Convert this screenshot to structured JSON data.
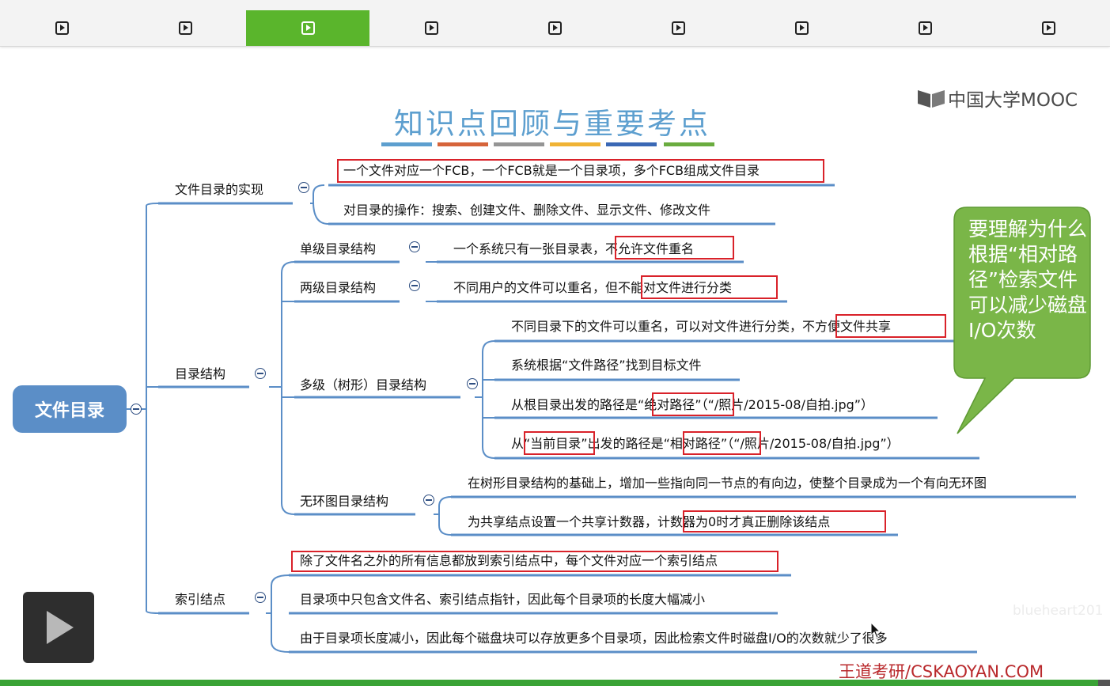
{
  "tabs": [
    {
      "icon": "play-icon",
      "active": false
    },
    {
      "icon": "play-icon",
      "active": false
    },
    {
      "icon": "play-icon",
      "active": true
    },
    {
      "icon": "play-icon",
      "active": false
    },
    {
      "icon": "play-icon",
      "active": false
    },
    {
      "icon": "play-icon",
      "active": false
    },
    {
      "icon": "play-icon",
      "active": false
    },
    {
      "icon": "play-icon",
      "active": false
    },
    {
      "icon": "play-icon",
      "active": false
    }
  ],
  "slide": {
    "title": "知识点回顾与重要考点",
    "stripe_colors": [
      "#5d9fcf",
      "#d6643a",
      "#959595",
      "#f0b335",
      "#3a68b5",
      "#6aac3f"
    ],
    "logo": "中国大学MOOC",
    "root": "文件目录",
    "branches": {
      "impl": {
        "label": "文件目录的实现",
        "items": [
          "一个文件对应一个FCB，一个FCB就是一个目录项，多个FCB组成文件目录",
          "对目录的操作：搜索、创建文件、删除文件、显示文件、修改文件"
        ]
      },
      "structure": {
        "label": "目录结构",
        "single": {
          "label": "单级目录结构",
          "desc_a": "一个系统只有一张目录表，",
          "desc_b": "不允许文件重名"
        },
        "two": {
          "label": "两级目录结构",
          "desc_a": "不同用户的文件可以重名，但",
          "desc_b": "不能对文件进行分类"
        },
        "multi": {
          "label": "多级（树形）目录结构",
          "i1a": "不同目录下的文件可以重名，可以对文件进行分类，",
          "i1b": "不方便文件共享",
          "i2": "系统根据“文件路径”找到目标文件",
          "i3a": "从根目录出发的路径是",
          "i3b": "“绝对路径”",
          "i3c": "（“/照片/2015-08/自拍.jpg”）",
          "i4a": "从",
          "i4b": "“当前目录”",
          "i4c": "出发的路径是",
          "i4d": "“相对路径”",
          "i4e": "（“/照片/2015-08/自拍.jpg”）"
        },
        "acyclic": {
          "label": "无环图目录结构",
          "i1": "在树形目录结构的基础上，增加一些指向同一节点的有向边，使整个目录成为一个有向无环图",
          "i2a": "为共享结点设置一个共享计数器，",
          "i2b": "计数器为0时才真正删除该结点"
        }
      },
      "inode": {
        "label": "索引结点",
        "items": [
          "除了文件名之外的所有信息都放到索引结点中，每个文件对应一个索引结点",
          "目录项中只包含文件名、索引结点指针，因此每个目录项的长度大幅减小",
          "由于目录项长度减小，因此每个磁盘块可以存放更多个目录项，因此检索文件时磁盘I/O的次数就少了很多"
        ]
      }
    },
    "callout": "要理解为什么根据“相对路径”检索文件可以减少磁盘I/O次数",
    "watermark": "blueheart201",
    "footer": "王道考研/CSKAOYAN.COM"
  },
  "colors": {
    "accent_green": "#5ab52c",
    "branch_blue": "#5b8ec7",
    "highlight_red": "#d9222a",
    "callout_green": "#7ab648"
  }
}
